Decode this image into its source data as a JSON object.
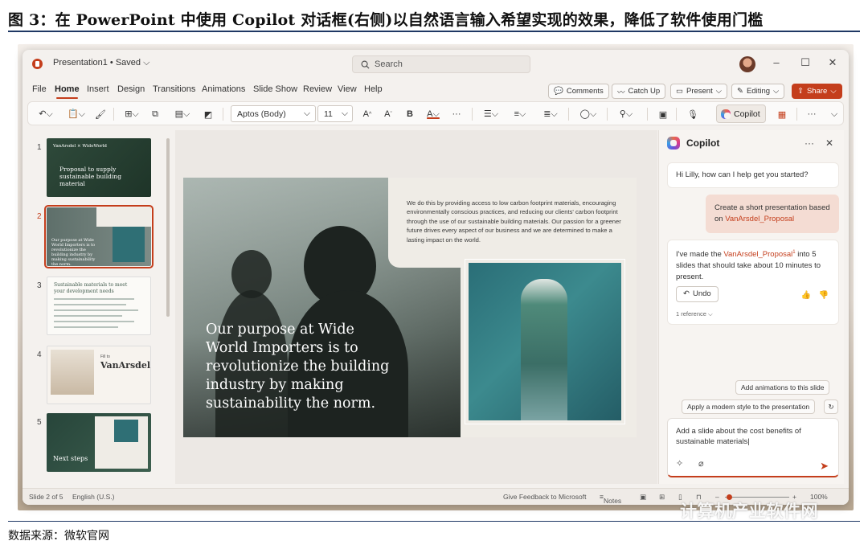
{
  "figure": {
    "caption": "图 3：在 PowerPoint 中使用 Copilot 对话框(右侧)以自然语言输入希望实现的效果，降低了软件使用门槛",
    "source": "数据来源：微软官网",
    "watermark": "计算机产业软件网"
  },
  "titlebar": {
    "doc_title": "Presentation1 • Saved ⌵",
    "search_placeholder": "Search"
  },
  "menu": {
    "tabs": [
      "File",
      "Home",
      "Insert",
      "Design",
      "Transitions",
      "Animations",
      "Slide Show",
      "Review",
      "View",
      "Help"
    ],
    "active": "Home",
    "comments": "Comments",
    "catch_up": "Catch Up",
    "present": "Present",
    "editing": "Editing",
    "share": "Share"
  },
  "toolbar": {
    "font_name": "Aptos (Body)",
    "font_size": "11",
    "copilot": "Copilot"
  },
  "thumbnails": {
    "numbers": [
      "1",
      "2",
      "3",
      "4",
      "5"
    ],
    "t1_brand": "VanArsdel  ×  WideWorld",
    "t1_title": "Proposal to supply sustainable building material",
    "t2_text": "Our purpose at Wide World Importers is to revolutionize the building industry by making sustainability the norm.",
    "t3_title": "Sustainable materials to meet your development needs",
    "t4_brand": "VanArsdel",
    "t4_sub": "Fill to",
    "t5_title": "Next steps"
  },
  "slide": {
    "panel_text": "We do this by providing access to low carbon footprint materials, encouraging environmentally conscious practices, and reducing our clients' carbon footprint through the use of our sustainable building materials. Our passion for a greener future drives every aspect of our business and we are determined to make a lasting impact on the world.",
    "quote": "Our purpose at Wide World Importers is to revolutionize the building industry by making sustainability the norm."
  },
  "copilot": {
    "title": "Copilot",
    "greeting": "Hi Lilly, how can I help get you started?",
    "user_msg_prefix": "Create a short presentation based on ",
    "user_msg_link": "VanArsdel_Proposal",
    "reply_prefix": "I've made the ",
    "reply_link": "VanArsdel_Proposal",
    "reply_ref_mark": "1",
    "reply_suffix": " into 5 slides that should take about 10 minutes to present.",
    "undo": "Undo",
    "reference": "1 reference",
    "suggestion_1": "Add animations to this slide",
    "suggestion_2": "Apply a modern style to the presentation",
    "input_text": "Add a slide about the cost benefits of sustainable materials"
  },
  "status": {
    "slide_info": "Slide 2 of 5",
    "language": "English (U.S.)",
    "feedback": "Give Feedback to Microsoft",
    "notes": "Notes",
    "zoom": "100%"
  },
  "colors": {
    "accent": "#c43e1c",
    "user_bubble": "#f4dcd3",
    "caption_rule": "#1f3864"
  }
}
